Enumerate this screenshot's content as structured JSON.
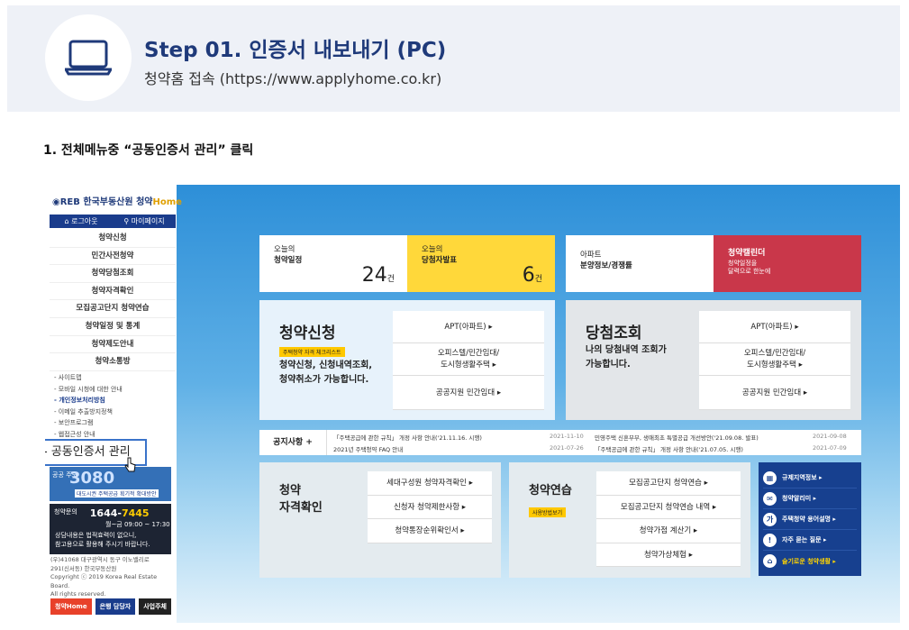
{
  "header": {
    "title": "Step 01. 인증서 내보내기 (PC)",
    "subtitle": "청약홈 접속 (https://www.applyhome.co.kr)",
    "icon": "laptop-icon"
  },
  "instruction": "1. 전체메뉴중 “공동인증서 관리” 클릭",
  "sidebar": {
    "logo_org": "한국부동산원",
    "logo_app": "청약",
    "logo_home": "Home",
    "login": "로그아웃",
    "mypage": "마이페이지",
    "menu": [
      "청약신청",
      "민간사전청약",
      "청약당첨조회",
      "청약자격확인",
      "모집공고단지 청약연습",
      "청약일정 및 통계",
      "청약제도안내",
      "청약소통방"
    ],
    "links": [
      "- 사이트맵",
      "- 모바일 시청에 대한 안내",
      "- 개인정보처리방침",
      "- 이메일 추출방지정책",
      "- 보안프로그램",
      "- 웹접근성 안내"
    ],
    "cert_link": "- 공동인증서 관리",
    "promo_small": "공공 주도",
    "promo_big": "3080",
    "promo_note": "대도시권 주택공급 획기적 확대방안",
    "contact_label": "청약문의",
    "contact_tel_prefix": "1644-",
    "contact_tel_suffix": "7445",
    "contact_hours": "월~금 09:00 ~ 17:30",
    "contact_note1": "상담내용은 법적효력이 없으니,",
    "contact_note2": "참고용으로 활용해 주시기 바랍니다.",
    "addr1": "(우)41068 대구광역시 동구 이노밸리로",
    "addr2": "291(신서동) 한국부동산원",
    "copy1": "Copyright ⓒ 2019 Korea Real Estate Board.",
    "copy2": "All rights reserved.",
    "footer_btns": [
      "청약Home",
      "은행 담당자",
      "사업주체"
    ]
  },
  "cards": {
    "schedule_l1": "오늘의",
    "schedule_l2": "청약일정",
    "schedule_count": "24",
    "winner_l1": "오늘의",
    "winner_l2": "당첨자발표",
    "winner_count": "6",
    "unit": "건",
    "apt_l1": "아파트",
    "apt_l2": "분양정보/경쟁률",
    "cal_l1": "청약캘린더",
    "cal_l2": "청약일정을",
    "cal_l3": "달력으로 한눈에"
  },
  "apply": {
    "title": "청약신청",
    "tag": "주택청약 자격 체크리스트",
    "desc1": "청약신청, 신청내역조회,",
    "desc2": "청약취소가 가능합니다.",
    "opt1": "APT(아파트) ▸",
    "opt2a": "오피스텔/민간임대/",
    "opt2b": "도시형생활주택  ▸",
    "opt3": "공공지원 민간임대 ▸"
  },
  "win": {
    "title": "당첨조회",
    "desc1": "나의 당첨내역 조회가",
    "desc2": "가능합니다.",
    "opt1": "APT(아파트) ▸",
    "opt2a": "오피스텔/민간임대/",
    "opt2b": "도시형생활주택  ▸",
    "opt3": "공공지원 민간임대 ▸"
  },
  "notice": {
    "label": "공지사항 +",
    "items": [
      {
        "text": "「주택공급에 관한 규칙」 개정 사항 안내('21.11.16. 시행)",
        "date": "2021-11-10"
      },
      {
        "text": "2021년 주택청약 FAQ 안내",
        "date": "2021-07-26"
      },
      {
        "text": "민영주택 신혼부부, 생애최초 특별공급 개선방안('21.09.08. 발표)",
        "date": "2021-09-08"
      },
      {
        "text": "「주택공급에 관한 규칙」 개정 사항 안내('21.07.05. 시행)",
        "date": "2021-07-09"
      }
    ]
  },
  "qual": {
    "title1": "청약",
    "title2": "자격확인",
    "opts": [
      "세대구성원 청약자격확인 ▸",
      "신청자 청약제한사항 ▸",
      "청약통장순위확인서 ▸"
    ]
  },
  "practice": {
    "title": "청약연습",
    "tag": "사용방법보기",
    "opts": [
      "모집공고단지 청약연습 ▸",
      "모집공고단지 청약연습 내역 ▸",
      "청약가점 계산기 ▸",
      "청약가상체험 ▸"
    ]
  },
  "quick": [
    {
      "icon": "grid-icon",
      "glyph": "▦",
      "label": "규제지역정보 ▸"
    },
    {
      "icon": "mail-icon",
      "glyph": "✉",
      "label": "청약알리미 ▸"
    },
    {
      "icon": "glossary-icon",
      "glyph": "가",
      "label": "주택청약 용어설명 ▸"
    },
    {
      "icon": "faq-icon",
      "glyph": "!",
      "label": "자주 묻는 질문 ▸"
    },
    {
      "icon": "life-icon",
      "glyph": "⌂",
      "label": "슬기로운 청약생활 ▸"
    }
  ],
  "colors": {
    "accent": "#1f3a7a",
    "highlight_border": "#3a73c9",
    "yellow": "#ffd83a",
    "red": "#c9374a",
    "navy": "#17408f"
  }
}
